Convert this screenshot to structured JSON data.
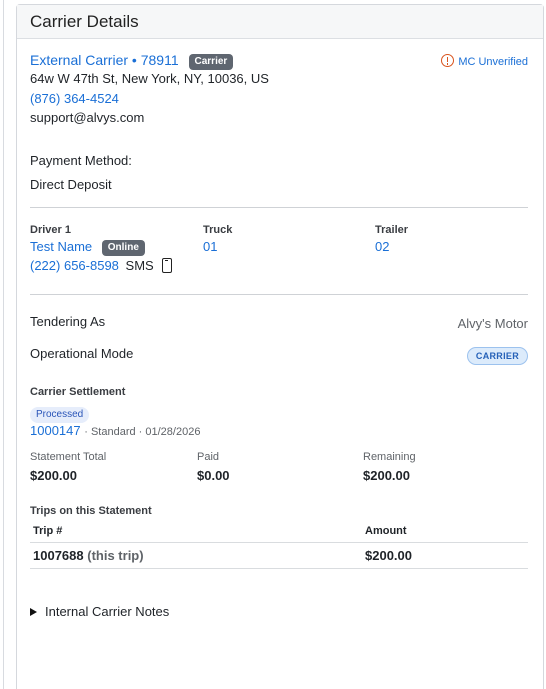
{
  "panel": {
    "title": "Carrier Details"
  },
  "carrier": {
    "name": "External Carrier • 78911",
    "type_badge": "Carrier",
    "address": "64w W 47th St, New York, NY, 10036, US",
    "phone": "(876) 364-4524",
    "email": "support@alvys.com",
    "mc_status": "MC Unverified"
  },
  "payment": {
    "label": "Payment Method:",
    "value": "Direct Deposit"
  },
  "assets": {
    "driver_label": "Driver 1",
    "driver_name": "Test Name",
    "driver_status": "Online",
    "driver_phone": "(222) 656-8598",
    "driver_sms": "SMS",
    "truck_label": "Truck",
    "truck_value": "01",
    "trailer_label": "Trailer",
    "trailer_value": "02"
  },
  "tendering": {
    "label": "Tendering As",
    "value": "Alvy's Motor"
  },
  "operational": {
    "label": "Operational Mode",
    "value": "CARRIER"
  },
  "settlement": {
    "label": "Carrier Settlement",
    "status": "Processed",
    "number": "1000147",
    "meta": "· Standard · 01/28/2026",
    "totals": [
      {
        "label": "Statement Total",
        "value": "$200.00"
      },
      {
        "label": "Paid",
        "value": "$0.00"
      },
      {
        "label": "Remaining",
        "value": "$200.00"
      }
    ]
  },
  "trips": {
    "label": "Trips on this Statement",
    "columns": [
      "Trip #",
      "Amount"
    ],
    "rows": [
      {
        "trip": "1007688",
        "note": "(this trip)",
        "amount": "$200.00"
      }
    ]
  },
  "notes": {
    "label": "Internal Carrier Notes"
  },
  "colors": {
    "link": "#1a6fd6",
    "warning": "#d9541e",
    "badge_dark": "#5f6670"
  },
  "icons": {
    "warning": "warning-circle-icon",
    "phone": "mobile-phone-icon",
    "expand": "triangle-right-icon"
  }
}
